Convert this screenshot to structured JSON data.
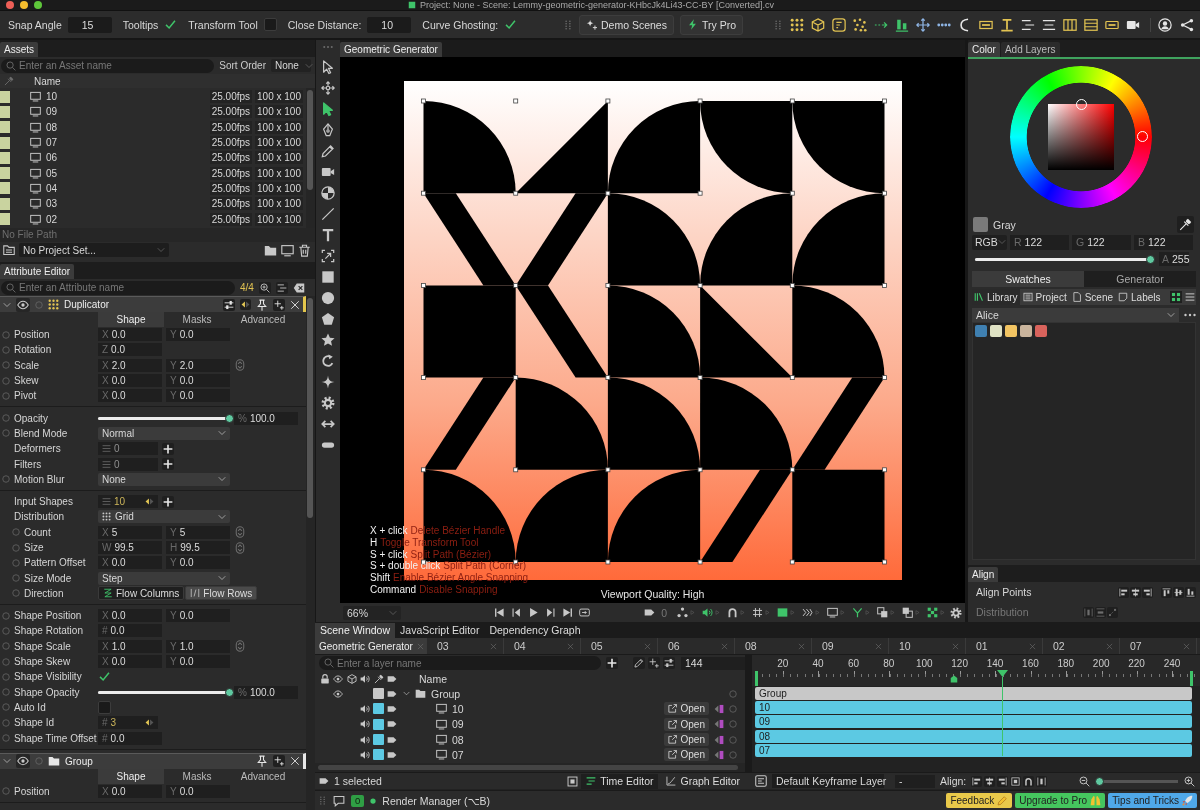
{
  "window": {
    "title": "Project: None - Scene: Lemmy-geometric-generator-KHbcJk4Li43-CC-BY [Converted].cv"
  },
  "toolbar": {
    "settings": [
      {
        "kind": "number",
        "label": "Snap Angle",
        "value": "15"
      },
      {
        "kind": "check",
        "label": "Tooltips",
        "checked": true
      },
      {
        "kind": "check",
        "label": "Transform Tool",
        "checked": false
      },
      {
        "kind": "number",
        "label": "Close Distance:",
        "value": "10"
      },
      {
        "kind": "check",
        "label": "Curve Ghosting:",
        "checked": true
      }
    ],
    "buttons": [
      {
        "kind": "demo",
        "label": "Demo Scenes"
      },
      {
        "kind": "pro",
        "label": "Try Pro"
      }
    ]
  },
  "assets": {
    "tab": "Assets",
    "search": {
      "placeholder": "Enter an Asset name"
    },
    "sort_label": "Sort Order",
    "sort_value": "None",
    "column": "Name",
    "rows": [
      {
        "name": "10",
        "fps": "25.00fps",
        "size": "100 x 100",
        "color": "#c9d39f"
      },
      {
        "name": "09",
        "fps": "25.00fps",
        "size": "100 x 100",
        "color": "#c9d39f"
      },
      {
        "name": "08",
        "fps": "25.00fps",
        "size": "100 x 100",
        "color": "#c9d39f"
      },
      {
        "name": "07",
        "fps": "25.00fps",
        "size": "100 x 100",
        "color": "#c9d39f"
      },
      {
        "name": "06",
        "fps": "25.00fps",
        "size": "100 x 100",
        "color": "#c9d39f"
      },
      {
        "name": "05",
        "fps": "25.00fps",
        "size": "100 x 100",
        "color": "#c9d39f"
      },
      {
        "name": "04",
        "fps": "25.00fps",
        "size": "100 x 100",
        "color": "#c9d39f"
      },
      {
        "name": "03",
        "fps": "25.00fps",
        "size": "100 x 100",
        "color": "#c9d39f"
      },
      {
        "name": "02",
        "fps": "25.00fps",
        "size": "100 x 100",
        "color": "#c9d39f"
      }
    ],
    "file_path": "No File Path",
    "project": "No Project Set..."
  },
  "attribute_editor": {
    "tab": "Attribute Editor",
    "search": {
      "placeholder": "Enter an Attribute name"
    },
    "count": "4/4",
    "layers": [
      {
        "name": "Duplicator",
        "kind": "duplicator",
        "tabs": [
          {
            "label": "Shape",
            "selected": true
          },
          {
            "label": "Masks",
            "selected": false
          },
          {
            "label": "Advanced",
            "selected": false
          }
        ],
        "sections": [
          [
            {
              "label": "Position",
              "kind": "vector",
              "keyable": true,
              "fields": [
                {
                  "axis": "X",
                  "value": "0.0"
                },
                {
                  "axis": "Y",
                  "value": "0.0"
                }
              ]
            },
            {
              "label": "Rotation",
              "kind": "vector",
              "keyable": true,
              "fields": [
                {
                  "axis": "Z",
                  "value": "0.0"
                }
              ]
            },
            {
              "label": "Scale",
              "kind": "vector",
              "keyable": true,
              "ratio_lock": true,
              "fields": [
                {
                  "axis": "X",
                  "value": "2.0"
                },
                {
                  "axis": "Y",
                  "value": "2.0"
                }
              ]
            },
            {
              "label": "Skew",
              "kind": "vector",
              "keyable": true,
              "fields": [
                {
                  "axis": "X",
                  "value": "0.0"
                },
                {
                  "axis": "Y",
                  "value": "0.0"
                }
              ]
            },
            {
              "label": "Pivot",
              "kind": "vector",
              "keyable": true,
              "fields": [
                {
                  "axis": "X",
                  "value": "0.0"
                },
                {
                  "axis": "Y",
                  "value": "0.0"
                }
              ]
            }
          ],
          [
            {
              "label": "Opacity",
              "kind": "slider",
              "keyable": true,
              "level": 1,
              "unit": "%",
              "value": "100.0"
            },
            {
              "label": "Blend Mode",
              "kind": "dropdown",
              "keyable": true,
              "value": "Normal"
            },
            {
              "label": "Deformers",
              "kind": "stack",
              "keyable": false,
              "keyed": false,
              "value": "0"
            },
            {
              "label": "Filters",
              "kind": "stack",
              "keyable": false,
              "keyed": false,
              "value": "0"
            },
            {
              "label": "Motion Blur",
              "kind": "dropdown",
              "keyable": true,
              "value": "None"
            }
          ],
          [
            {
              "label": "Input Shapes",
              "kind": "stack",
              "keyable": false,
              "keyed": true,
              "value": "10"
            },
            {
              "label": "Distribution",
              "kind": "mode",
              "keyable": false,
              "value": "Grid",
              "children": [
                {
                  "label": "Count",
                  "kind": "vector",
                  "keyable": true,
                  "ratio_lock": true,
                  "fields": [
                    {
                      "axis": "X",
                      "value": "5"
                    },
                    {
                      "axis": "Y",
                      "value": "5"
                    }
                  ]
                },
                {
                  "label": "Size",
                  "kind": "vector",
                  "keyable": true,
                  "ratio_lock": true,
                  "fields": [
                    {
                      "axis": "W",
                      "value": "99.5"
                    },
                    {
                      "axis": "H",
                      "value": "99.5"
                    }
                  ]
                },
                {
                  "label": "Pattern Offset",
                  "kind": "vector",
                  "keyable": true,
                  "fields": [
                    {
                      "axis": "X",
                      "value": "0.0"
                    },
                    {
                      "axis": "Y",
                      "value": "0.0"
                    }
                  ]
                },
                {
                  "label": "Size Mode",
                  "kind": "dropdown",
                  "keyable": true,
                  "value": "Step"
                },
                {
                  "label": "Direction",
                  "kind": "segmented",
                  "keyable": true,
                  "options": [
                    {
                      "label": "Flow Columns",
                      "selected": true
                    },
                    {
                      "label": "Flow Rows",
                      "selected": false
                    }
                  ]
                }
              ]
            }
          ],
          [
            {
              "label": "Shape Position",
              "kind": "vector",
              "keyable": true,
              "fields": [
                {
                  "axis": "X",
                  "value": "0.0"
                },
                {
                  "axis": "Y",
                  "value": "0.0"
                }
              ]
            },
            {
              "label": "Shape Rotation",
              "kind": "vector",
              "keyable": true,
              "fields": [
                {
                  "axis": "#",
                  "value": "0.0"
                }
              ]
            },
            {
              "label": "Shape Scale",
              "kind": "vector",
              "keyable": true,
              "ratio_lock": true,
              "fields": [
                {
                  "axis": "X",
                  "value": "1.0"
                },
                {
                  "axis": "Y",
                  "value": "1.0"
                }
              ]
            },
            {
              "label": "Shape Skew",
              "kind": "vector",
              "keyable": true,
              "fields": [
                {
                  "axis": "X",
                  "value": "0.0"
                },
                {
                  "axis": "Y",
                  "value": "0.0"
                }
              ]
            },
            {
              "label": "Shape Visibility",
              "kind": "check",
              "keyable": true,
              "checked": true
            },
            {
              "label": "Shape Opacity",
              "kind": "slider",
              "keyable": true,
              "level": 1,
              "unit": "%",
              "value": "100.0"
            },
            {
              "label": "Auto Id",
              "kind": "check",
              "keyable": true,
              "checked": false
            },
            {
              "label": "Shape Id",
              "kind": "number",
              "keyable": true,
              "keyed": true,
              "axis": "#",
              "value": "3"
            },
            {
              "label": "Shape Time Offset",
              "kind": "vector",
              "keyable": true,
              "fields": [
                {
                  "axis": "#",
                  "value": "0.0"
                }
              ]
            }
          ]
        ]
      },
      {
        "name": "Group",
        "kind": "group",
        "tabs": [
          {
            "label": "Shape",
            "selected": true
          },
          {
            "label": "Masks",
            "selected": false
          },
          {
            "label": "Advanced",
            "selected": false
          }
        ],
        "sections": [
          [
            {
              "label": "Position",
              "kind": "vector",
              "keyable": true,
              "fields": [
                {
                  "axis": "X",
                  "value": "0.0"
                },
                {
                  "axis": "Y",
                  "value": "0.0"
                }
              ]
            }
          ]
        ]
      }
    ]
  },
  "tool_strip": {
    "tools": [
      {
        "selected": false
      },
      {
        "selected": false
      },
      {
        "selected": true
      },
      {
        "selected": false
      },
      {
        "selected": false
      },
      {
        "selected": false
      },
      {
        "selected": false
      },
      {
        "selected": false
      },
      {
        "selected": false
      },
      {
        "selected": false
      },
      {
        "selected": false
      },
      {
        "selected": false
      },
      {
        "selected": false
      },
      {
        "selected": false
      },
      {
        "selected": false
      },
      {
        "selected": false
      },
      {
        "selected": false
      },
      {
        "selected": false
      },
      {
        "selected": false
      }
    ]
  },
  "viewport": {
    "tab": "Geometric Generator",
    "hints": [
      {
        "keys": "X + click",
        "action": "Delete Bézier Handle"
      },
      {
        "keys": "H",
        "action": "Toggle Transform Tool"
      },
      {
        "keys": "S + click",
        "action": "Split Path (Bézier)"
      },
      {
        "keys": "S + double click",
        "action": "Split Path (Corner)"
      },
      {
        "keys": "Shift",
        "action": "Enable Bézier Angle Snapping"
      },
      {
        "keys": "Command",
        "action": "Disable Snapping"
      }
    ],
    "quality": "Viewport Quality: High",
    "zoom": "66%",
    "frame": "0",
    "toggles": [
      {
        "on": false
      },
      {
        "on": true
      },
      {
        "on": false
      },
      {
        "on": false
      },
      {
        "on": true
      },
      {
        "on": false
      },
      {
        "on": false
      },
      {
        "on": true
      },
      {
        "on": false
      },
      {
        "on": false
      },
      {
        "on": true
      }
    ]
  },
  "color_panel": {
    "tabs": [
      {
        "label": "Color",
        "selected": true
      },
      {
        "label": "Add Layers",
        "selected": false
      }
    ],
    "name": "Gray",
    "model": "RGB",
    "channels": [
      {
        "axis": "R",
        "value": "122"
      },
      {
        "axis": "G",
        "value": "122"
      },
      {
        "axis": "B",
        "value": "122"
      }
    ],
    "alpha": {
      "axis": "A",
      "value": "255",
      "level": 1
    },
    "swatch_tabs": [
      {
        "label": "Swatches",
        "selected": true
      },
      {
        "label": "Generator",
        "selected": false
      }
    ],
    "sources": [
      {
        "label": "Library",
        "selected": true
      },
      {
        "label": "Project",
        "selected": false
      },
      {
        "label": "Scene",
        "selected": false
      },
      {
        "label": "Labels",
        "selected": false
      }
    ],
    "views": [
      {
        "selected": true
      },
      {
        "selected": false
      }
    ],
    "palette": "Alice",
    "swatches": [
      {
        "color": "#3f80b1"
      },
      {
        "color": "#dfe2c4"
      },
      {
        "color": "#f2c462"
      },
      {
        "color": "#c9b49c"
      },
      {
        "color": "#d9635c"
      }
    ]
  },
  "align_panel": {
    "tab": "Align",
    "rows": [
      {
        "label": "Align Points",
        "disabled": false
      },
      {
        "label": "Distribution",
        "disabled": true
      }
    ]
  },
  "timeline": {
    "tabs": [
      {
        "label": "Scene Window",
        "selected": true
      },
      {
        "label": "JavaScript Editor",
        "selected": false
      },
      {
        "label": "Dependency Graph",
        "selected": false
      }
    ],
    "scenes": [
      {
        "label": "Geometric Generator",
        "selected": true
      },
      {
        "label": "03",
        "selected": false
      },
      {
        "label": "04",
        "selected": false
      },
      {
        "label": "05",
        "selected": false
      },
      {
        "label": "06",
        "selected": false
      },
      {
        "label": "08",
        "selected": false
      },
      {
        "label": "09",
        "selected": false
      },
      {
        "label": "10",
        "selected": false
      },
      {
        "label": "01",
        "selected": false
      },
      {
        "label": "02",
        "selected": false
      },
      {
        "label": "07",
        "selected": false
      }
    ],
    "search": {
      "placeholder": "Enter a layer name"
    },
    "frame": "144",
    "column": "Name",
    "layers": [
      {
        "name": "Group",
        "kind": "group",
        "color": "#c8c8c8",
        "expanded": true,
        "children": [
          {
            "name": "10",
            "kind": "shape",
            "color": "#5cc9e3",
            "action": "Open"
          },
          {
            "name": "09",
            "kind": "shape",
            "color": "#5cc9e3",
            "action": "Open"
          },
          {
            "name": "08",
            "kind": "shape",
            "color": "#5cc9e3",
            "action": "Open"
          },
          {
            "name": "07",
            "kind": "shape",
            "color": "#5cc9e3",
            "action": "Open"
          }
        ]
      }
    ],
    "ruler": [
      "20",
      "40",
      "60",
      "80",
      "100",
      "120",
      "140",
      "160",
      "180",
      "200",
      "220",
      "240"
    ],
    "playhead": {
      "level": 0.56
    },
    "keyframe": {
      "level": 0.45
    },
    "bars": [
      {
        "label": "Group",
        "color": "#c8c8c8"
      },
      {
        "label": "10",
        "color": "#5cc9e3"
      },
      {
        "label": "09",
        "color": "#5cc9e3"
      },
      {
        "label": "08",
        "color": "#5cc9e3"
      },
      {
        "label": "07",
        "color": "#5cc9e3"
      }
    ],
    "selection": "1 selected",
    "editors": [
      {
        "label": "Time Editor",
        "selected": true
      },
      {
        "label": "Graph Editor",
        "selected": false
      }
    ],
    "keyframe_layer": "Default Keyframe Layer",
    "keyframe_value": "-",
    "align_label": "Align:",
    "zoom": {
      "level": 0.05
    }
  },
  "status_bar": {
    "badge": "0",
    "task": "Render Manager (⌥B)",
    "buttons": [
      {
        "kind": "feedback",
        "label": "Feedback"
      },
      {
        "kind": "upgrade",
        "label": "Upgrade to Pro"
      },
      {
        "kind": "tips",
        "label": "Tips and Tricks"
      }
    ]
  }
}
